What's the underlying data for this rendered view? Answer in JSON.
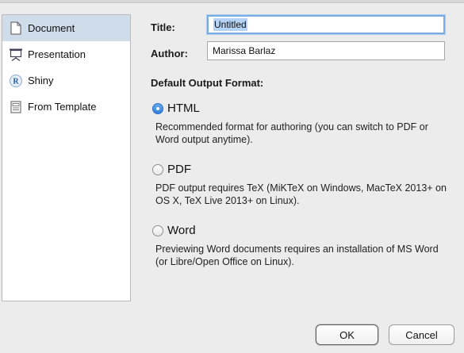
{
  "sidebar": {
    "items": [
      {
        "label": "Document",
        "icon": "document-icon"
      },
      {
        "label": "Presentation",
        "icon": "presentation-icon"
      },
      {
        "label": "Shiny",
        "icon": "shiny-r-icon"
      },
      {
        "label": "From Template",
        "icon": "template-icon"
      }
    ]
  },
  "form": {
    "title_label": "Title:",
    "title_value": "Untitled",
    "author_label": "Author:",
    "author_value": "Marissa Barlaz",
    "output_heading": "Default Output Format:"
  },
  "formats": [
    {
      "label": "HTML",
      "checked": true,
      "description": "Recommended format for authoring (you can switch to PDF or Word output anytime)."
    },
    {
      "label": "PDF",
      "checked": false,
      "description": "PDF output requires TeX (MiKTeX on Windows, MacTeX 2013+ on OS X, TeX Live 2013+ on Linux)."
    },
    {
      "label": "Word",
      "checked": false,
      "description": "Previewing Word documents requires an installation of MS Word (or Libre/Open Office on Linux)."
    }
  ],
  "buttons": {
    "ok_label": "OK",
    "cancel_label": "Cancel"
  },
  "colors": {
    "selection": "#cfdcea",
    "radio_checked": "#2f7fdd",
    "focus_ring": "#7aaee3"
  }
}
